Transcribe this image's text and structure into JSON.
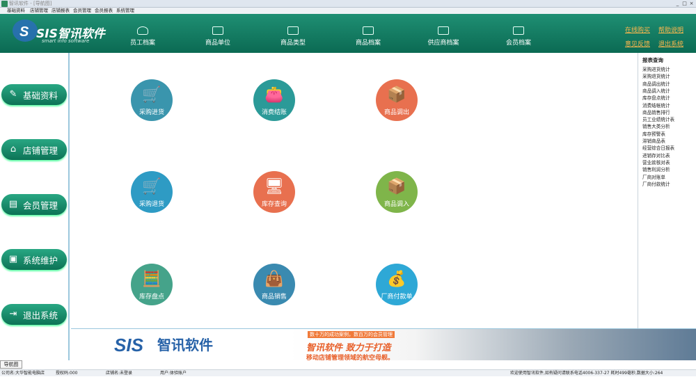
{
  "titlebar": {
    "title": "智讯软件 - [导航图]",
    "min": "_",
    "max": "□",
    "close": "×"
  },
  "menu": [
    "基础资料",
    "店铺管理",
    "店铺报表",
    "会员管理",
    "会员报表",
    "系统管理"
  ],
  "header": {
    "brand": "SIS智讯软件",
    "brand_sub": "smart info software",
    "buttons": [
      "员工档案",
      "商品单位",
      "商品类型",
      "商品档案",
      "供应商档案",
      "会员档案"
    ],
    "links": [
      "在线购买",
      "帮助说明",
      "意见反馈",
      "退出系统"
    ]
  },
  "leftnav": [
    "基础资料",
    "店铺管理",
    "会员管理",
    "系统维护",
    "退出系统"
  ],
  "tiles": [
    {
      "label": "采购进货",
      "color": "#3a95ad",
      "icon": "cart-icon"
    },
    {
      "label": "消费结账",
      "color": "#2b9a98",
      "icon": "wallet-icon"
    },
    {
      "label": "商品调出",
      "color": "#e8704f",
      "icon": "box-out-icon"
    },
    {
      "label": "采购退货",
      "color": "#2e9bc4",
      "icon": "cart-return-icon"
    },
    {
      "label": "库存查询",
      "color": "#e8704f",
      "icon": "monitor-icon"
    },
    {
      "label": "商品调入",
      "color": "#7fb54a",
      "icon": "box-in-icon"
    },
    {
      "label": "库存盘点",
      "color": "#45a38a",
      "icon": "calculator-icon"
    },
    {
      "label": "商品销售",
      "color": "#3a8ab0",
      "icon": "bag-icon"
    },
    {
      "label": "厂商付款单",
      "color": "#2ea8d6",
      "icon": "money-bag-icon"
    }
  ],
  "rightpanel": {
    "title": "报表查询",
    "items": [
      "采购进货统计",
      "采购退货统计",
      "商品调出统计",
      "商品调入统计",
      "库存盘点统计",
      "消费结帐统计",
      "商品销售排行",
      "员工业绩统计表",
      "销售大类分析",
      "库存预警表",
      "滞销商品表",
      "经营综合日报表",
      "进销存对比表",
      "营业款核对表",
      "销售利润分析",
      "厂商对账单",
      "厂商付款统计"
    ]
  },
  "banner": {
    "line1": "数十万的成功案例，数百万的会员管理",
    "line2": "智讯软件 致力于打造",
    "line3": "移动店铺管理领域的航空母舰。"
  },
  "navtab": "导航图",
  "status": [
    "公司名:大华智能电脑店",
    "授权码:000",
    "店铺名:未登录",
    "用户:体验账户",
    "欢迎使用智讯软件,如有疑问请联系电话4006-337-27 耗时499毫秒,数据大小:264"
  ]
}
